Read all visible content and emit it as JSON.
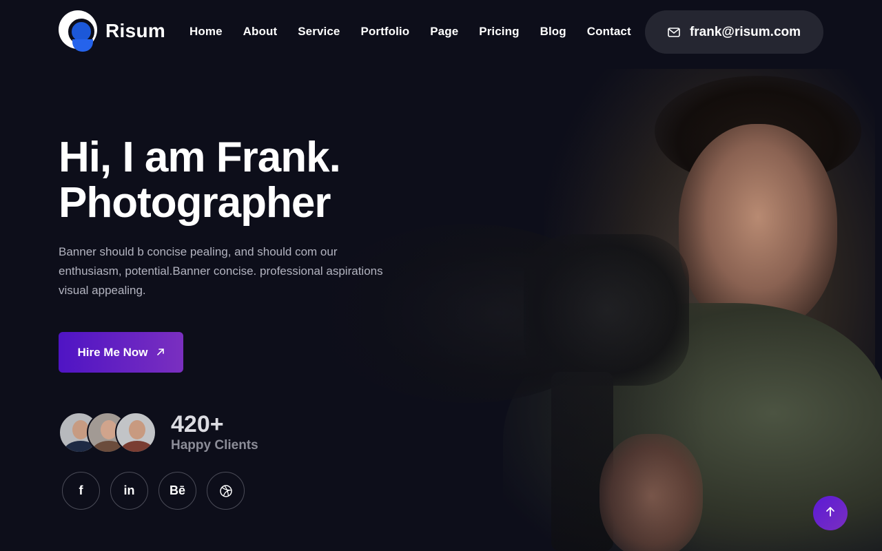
{
  "brand": {
    "name": "Risum"
  },
  "nav": {
    "items": [
      {
        "label": "Home"
      },
      {
        "label": "About"
      },
      {
        "label": "Service"
      },
      {
        "label": "Portfolio"
      },
      {
        "label": "Page"
      },
      {
        "label": "Pricing"
      },
      {
        "label": "Blog"
      },
      {
        "label": "Contact"
      }
    ]
  },
  "contact": {
    "email": "frank@risum.com",
    "icon": "mail-icon"
  },
  "hero": {
    "title_line1": "Hi, I am Frank.",
    "title_line2": "Photographer",
    "description": "Banner should b concise pealing, and should com our enthusiasm, potential.Banner concise. professional aspirations visual appealing.",
    "cta_label": "Hire Me Now",
    "cta_icon": "arrow-up-right-icon"
  },
  "clients": {
    "count": "420+",
    "label": "Happy Clients"
  },
  "socials": [
    {
      "name": "facebook-icon",
      "glyph": "f"
    },
    {
      "name": "linkedin-icon",
      "glyph": "in"
    },
    {
      "name": "behance-icon",
      "glyph": "Bē"
    },
    {
      "name": "dribbble-icon",
      "glyph": ""
    }
  ],
  "colors": {
    "background": "#0d0e1a",
    "accent_start": "#4f14c4",
    "accent_end": "#7a2fc0",
    "logo_blue": "#2563eb",
    "pill_bg": "#252631"
  }
}
